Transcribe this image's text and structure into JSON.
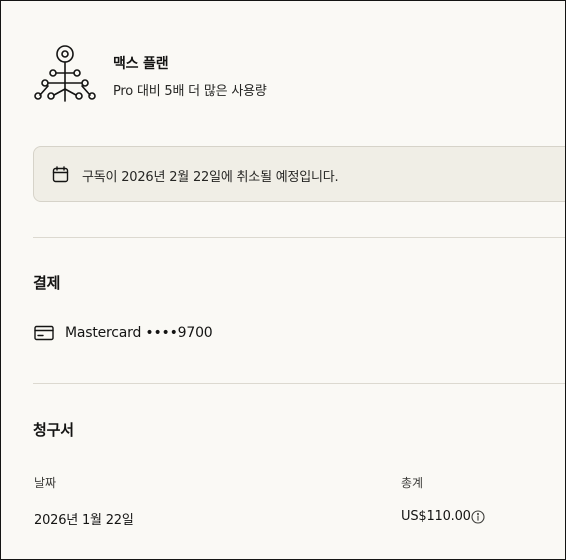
{
  "plan": {
    "icon": "branching-tree-icon",
    "name": "맥스 플랜",
    "description": "Pro 대비 5배 더 많은 사용량"
  },
  "notice": {
    "icon": "calendar-icon",
    "text": "구독이 2026년 2월 22일에 취소될 예정입니다."
  },
  "payment": {
    "title": "결제",
    "card_icon": "credit-card-icon",
    "card_text": "Mastercard ••••9700"
  },
  "invoices": {
    "title": "청구서",
    "columns": {
      "date": "날짜",
      "total": "총계"
    },
    "rows": [
      {
        "date": "2026년 1월 22일",
        "total": "US$110.00",
        "info_icon": "info-icon"
      }
    ]
  },
  "colors": {
    "background": "#faf9f5",
    "notice_bg": "#f0eee6",
    "text": "#141413",
    "divider": "#dcd9d0"
  }
}
